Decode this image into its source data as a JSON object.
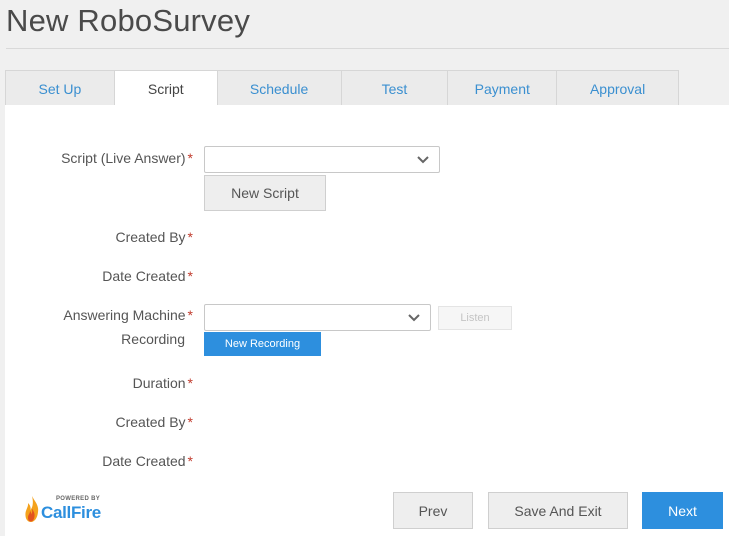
{
  "page": {
    "title": "New RoboSurvey"
  },
  "tabs": [
    {
      "label": "Set Up",
      "active": false
    },
    {
      "label": "Script",
      "active": true
    },
    {
      "label": "Schedule",
      "active": false
    },
    {
      "label": "Test",
      "active": false
    },
    {
      "label": "Payment",
      "active": false
    },
    {
      "label": "Approval",
      "active": false
    }
  ],
  "form": {
    "script_label": "Script (Live Answer)",
    "script_value": "",
    "new_script_button": "New Script",
    "created_by_label": "Created By",
    "date_created_label": "Date Created",
    "answering_machine_label_line1": "Answering Machine",
    "answering_machine_label_line2": "Recording",
    "recording_value": "",
    "listen_button": "Listen",
    "new_recording_button": "New Recording",
    "duration_label": "Duration",
    "created_by_label_2": "Created By",
    "date_created_label_2": "Date Created",
    "required_mark": "*"
  },
  "footer": {
    "logo_powered_by": "POWERED BY",
    "logo_brand": "CallFire",
    "prev_button": "Prev",
    "save_exit_button": "Save And Exit",
    "next_button": "Next"
  },
  "colors": {
    "accent": "#2d8fde",
    "required": "#c0392b",
    "tab_inactive_text": "#3a8fd0"
  }
}
